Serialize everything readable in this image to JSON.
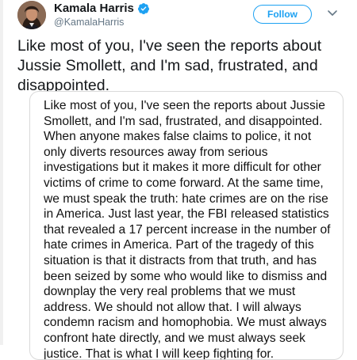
{
  "author": {
    "display_name": "Kamala Harris",
    "handle": "@KamalaHarris",
    "verified": true
  },
  "actions": {
    "follow_label": "Follow"
  },
  "tweet": {
    "text": "Like most of you, I've seen the reports about Jussie Smollett, and I'm sad, frustrated, and disappointed."
  },
  "statement_image": {
    "text": "Like most of you, I've seen the reports about Jussie Smollett, and I'm sad, frustrated, and disappointed. When anyone makes false claims to police, it not only diverts resources away from serious investigations but it makes it more difficult for other victims of crime to come forward. At the same time, we must speak the truth: hate crimes are on the rise in America. Just last year, the FBI released statistics that revealed a 17 percent increase in the number of hate crimes in America. Part of the tragedy of this situation is that it distracts from that truth, and has been seized by some who would like to dismiss and downplay the very real problems that we must address. We should not allow that. I will always condemn racism and homophobia. We must always confront hate directly, and we must always seek justice. That is what I will keep fighting for."
  },
  "colors": {
    "accent": "#1da1f2",
    "text": "#14171a",
    "muted": "#657786",
    "border": "#d9d9d9"
  },
  "icons": {
    "verified": "verified-badge-icon",
    "caret": "chevron-down-icon"
  }
}
